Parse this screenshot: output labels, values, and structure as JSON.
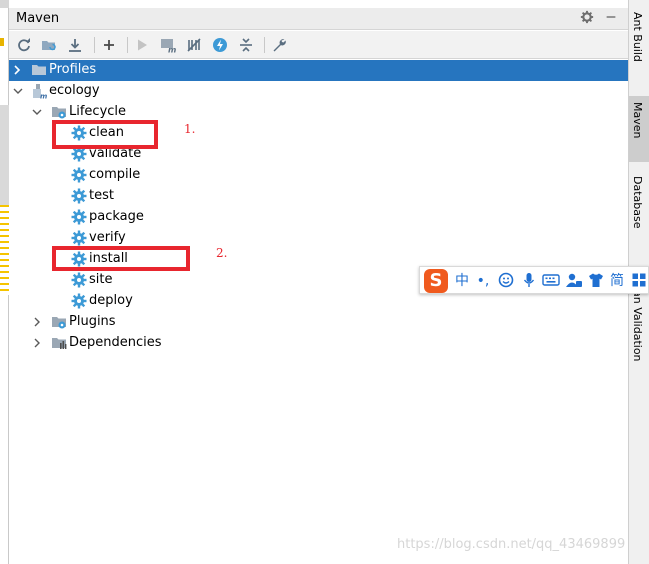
{
  "panel": {
    "title": "Maven"
  },
  "tree": {
    "profiles": "Profiles",
    "project": "ecology",
    "lifecycle": "Lifecycle",
    "phases": [
      "clean",
      "validate",
      "compile",
      "test",
      "package",
      "verify",
      "install",
      "site",
      "deploy"
    ],
    "plugins": "Plugins",
    "dependencies": "Dependencies"
  },
  "sidebar": {
    "tabs": [
      "Ant Build",
      "Maven",
      "Database",
      "an Validation"
    ],
    "active": "Maven"
  },
  "annotations": {
    "first": "1.",
    "second": "2."
  },
  "ime": {
    "logo": "S",
    "mode": "中",
    "punct": "•,",
    "simplified": "简"
  },
  "watermark": "https://blog.csdn.net/qq_43469899",
  "colors": {
    "selection": "#2675bf",
    "annotation": "#e8262e",
    "gear": "#3d9ad6",
    "folder": "#8fa8bf"
  },
  "icons": [
    "refresh-icon",
    "generate-sources-icon",
    "download-icon",
    "add-icon",
    "run-icon",
    "maven-goal-icon",
    "toggle-offline-icon",
    "skip-tests-icon",
    "collapse-all-icon",
    "settings-wrench-icon",
    "gear-icon",
    "minimize-icon"
  ]
}
